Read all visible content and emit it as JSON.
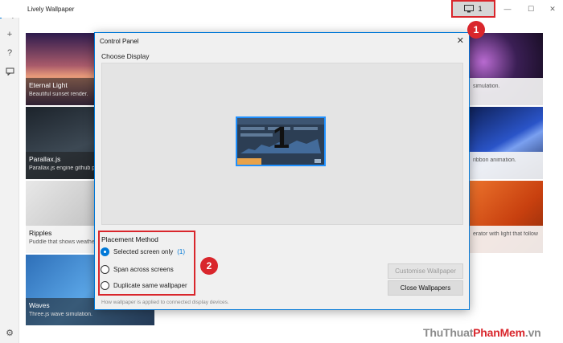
{
  "app": {
    "title": "Lively Wallpaper",
    "display_badge": "1"
  },
  "rail": [
    {
      "name": "library",
      "icon": "library-icon"
    },
    {
      "name": "add",
      "icon": "plus-icon"
    },
    {
      "name": "help",
      "icon": "question-icon"
    },
    {
      "name": "feedback",
      "icon": "chat-icon"
    },
    {
      "name": "settings",
      "icon": "gear-icon"
    }
  ],
  "tiles": [
    {
      "title": "Eternal Light",
      "desc": "Beautiful sunset render.",
      "color": "#6b4a8a"
    },
    {
      "title": "Parallax.js",
      "desc": "Parallax.js engine github p",
      "color": "#3a4450"
    },
    {
      "title": "Ripples",
      "desc": "Puddle that shows weathe",
      "color": "#cfcfcf"
    },
    {
      "title": "Waves",
      "desc": "Three.js wave simulation.",
      "color": "#4a8fd0"
    },
    {
      "title": "",
      "desc": "simulation.",
      "color": "#3b1f55"
    },
    {
      "title": "",
      "desc": "ribbon animation.",
      "color": "#1f3a8a"
    },
    {
      "title": "",
      "desc": "erator with light that follow",
      "color": "#d4521a"
    }
  ],
  "dialog": {
    "title": "Control Panel",
    "choose_display": "Choose Display",
    "monitor_number": "1",
    "placement_title": "Placement Method",
    "options": [
      {
        "label": "Selected screen only",
        "suffix": "(1)",
        "selected": true
      },
      {
        "label": "Span across screens",
        "suffix": "",
        "selected": false
      },
      {
        "label": "Duplicate same wallpaper",
        "suffix": "",
        "selected": false
      }
    ],
    "hint": "How wallpaper is applied to connected display devices.",
    "customise_label": "Customise Wallpaper",
    "close_label": "Close Wallpapers"
  },
  "annotations": {
    "step1": "1",
    "step2": "2"
  },
  "watermark": "ThuThuatPhanMem.vn",
  "colors": {
    "accent": "#0078d7",
    "highlight": "#d9262c"
  }
}
